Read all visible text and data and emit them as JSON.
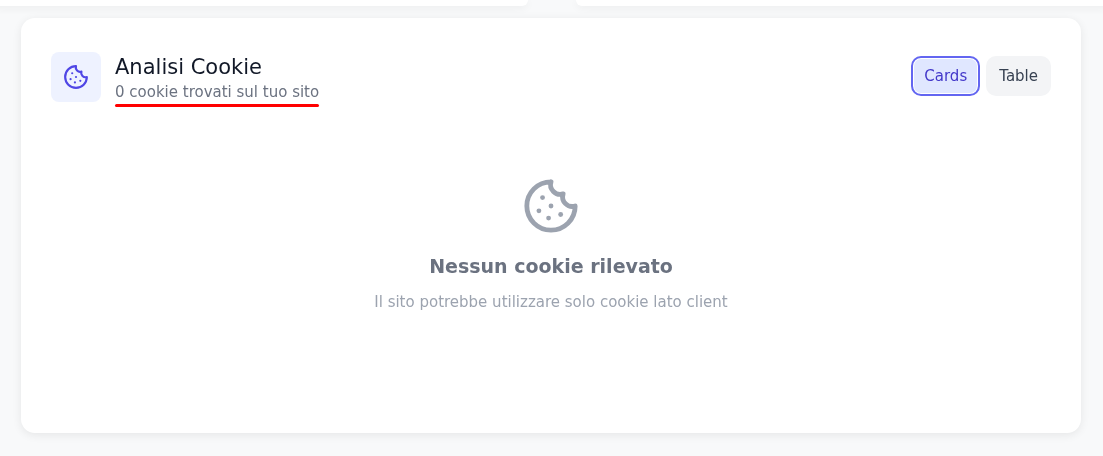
{
  "header": {
    "title": "Analisi Cookie",
    "subtitle": {
      "text": "0 cookie trovati sul tuo sito",
      "underlined": true
    }
  },
  "view_toggle": [
    {
      "label": "Cards",
      "selected": true
    },
    {
      "label": "Table",
      "selected": false
    }
  ],
  "empty_state": {
    "title": "Nessun cookie rilevato",
    "message": "Il sito potrebbe utilizzare solo cookie lato client"
  }
}
